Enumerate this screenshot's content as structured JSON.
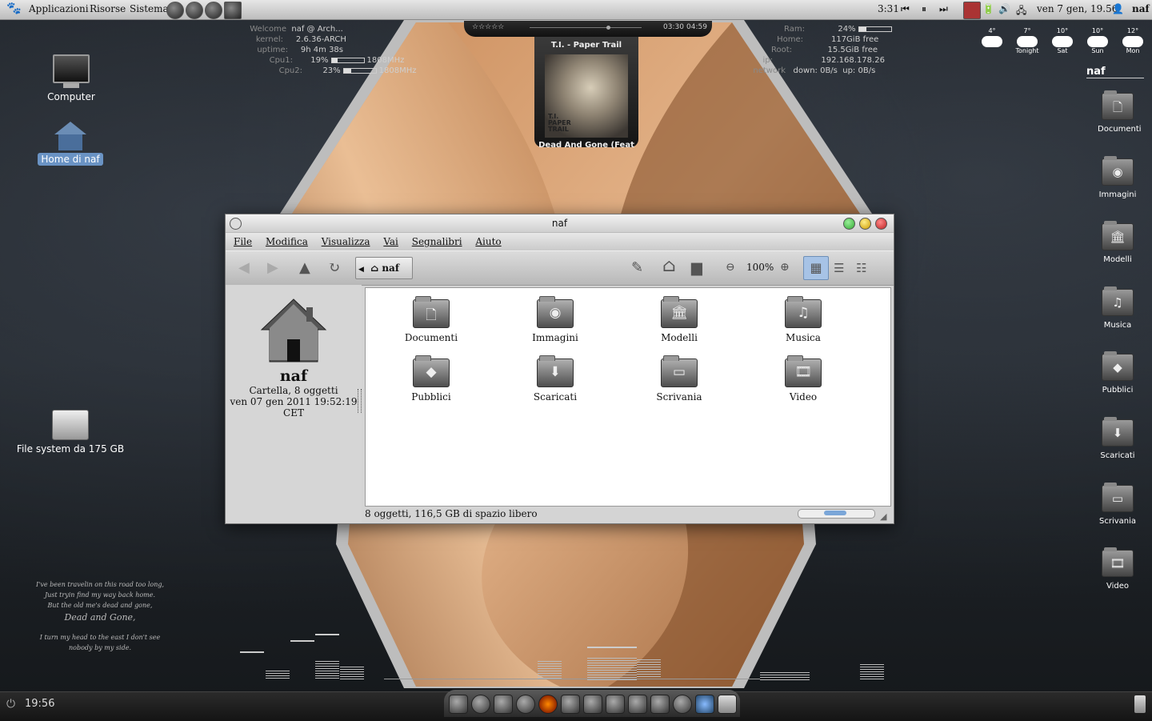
{
  "top_panel": {
    "menus": [
      "Applicazioni",
      "Risorse",
      "Sistema"
    ],
    "time_small": "3:31",
    "datetime": "ven 7 gen, 19.56",
    "user": "naf"
  },
  "conky_left": {
    "welcome_label": "Welcome",
    "welcome_value": "naf @ Arch...",
    "kernel_label": "kernel:",
    "kernel_value": "2.6.36-ARCH",
    "uptime_label": "uptime:",
    "uptime_value": "9h 4m 38s",
    "cpu1_label": "Cpu1:",
    "cpu1_value": "19%",
    "cpu1_freq": "1808MHz",
    "cpu1_fraction": 0.19,
    "cpu2_label": "Cpu2:",
    "cpu2_value": "23%",
    "cpu2_freq": "1808MHz",
    "cpu2_fraction": 0.23
  },
  "conky_right": {
    "ram_label": "Ram:",
    "ram_value": "24%",
    "ram_fraction": 0.24,
    "home_label": "Home:",
    "home_value": "117GiB free",
    "root_label": "Root:",
    "root_value": "15.5GiB free",
    "ip_label": "ip:",
    "ip_value": "192.168.178.26",
    "network_label": "network",
    "down_value": "down: 0B/s",
    "up_value": "up: 0B/s"
  },
  "music": {
    "rating": "☆☆☆☆☆",
    "elapsed": "03:30",
    "total": "04:59",
    "album": "T.I. - Paper Trail",
    "cover_text": "T.I. PAPER TRAIL",
    "track": "Dead And Gone (Feat"
  },
  "weather": [
    {
      "temp": "4°",
      "day": ""
    },
    {
      "temp": "7°",
      "day": "Tonight"
    },
    {
      "temp": "10°",
      "day": "Sat"
    },
    {
      "temp": "10°",
      "day": "Sun"
    },
    {
      "temp": "12°",
      "day": "Mon"
    }
  ],
  "right_panel": {
    "title": "naf",
    "folders": [
      "Documenti",
      "Immagini",
      "Modelli",
      "Musica",
      "Pubblici",
      "Scaricati",
      "Scrivania",
      "Video"
    ]
  },
  "desktop": {
    "computer": "Computer",
    "home": "Home di naf",
    "filesystem": "File system da 175 GB"
  },
  "window": {
    "title": "naf",
    "menu": [
      "File",
      "Modifica",
      "Visualizza",
      "Vai",
      "Segnalibri",
      "Aiuto"
    ],
    "breadcrumb": "naf",
    "zoom": "100%",
    "side": {
      "name": "naf",
      "info": "Cartella, 8 oggetti",
      "date": "ven 07 gen 2011 19:52:19 CET"
    },
    "items": [
      "Documenti",
      "Immagini",
      "Modelli",
      "Musica",
      "Pubblici",
      "Scaricati",
      "Scrivania",
      "Video"
    ],
    "status": "8 oggetti, 116,5 GB di spazio libero"
  },
  "lyrics": {
    "l1": "I've been travelin on this road too long,",
    "l2": "Just tryin find my way back home.",
    "l3": "But the old me's dead and gone,",
    "l4": "Dead and Gone,",
    "l5": "I turn my head to the east I don't see",
    "l6": "nobody by my side."
  },
  "bottom_panel": {
    "clock": "19:56"
  }
}
